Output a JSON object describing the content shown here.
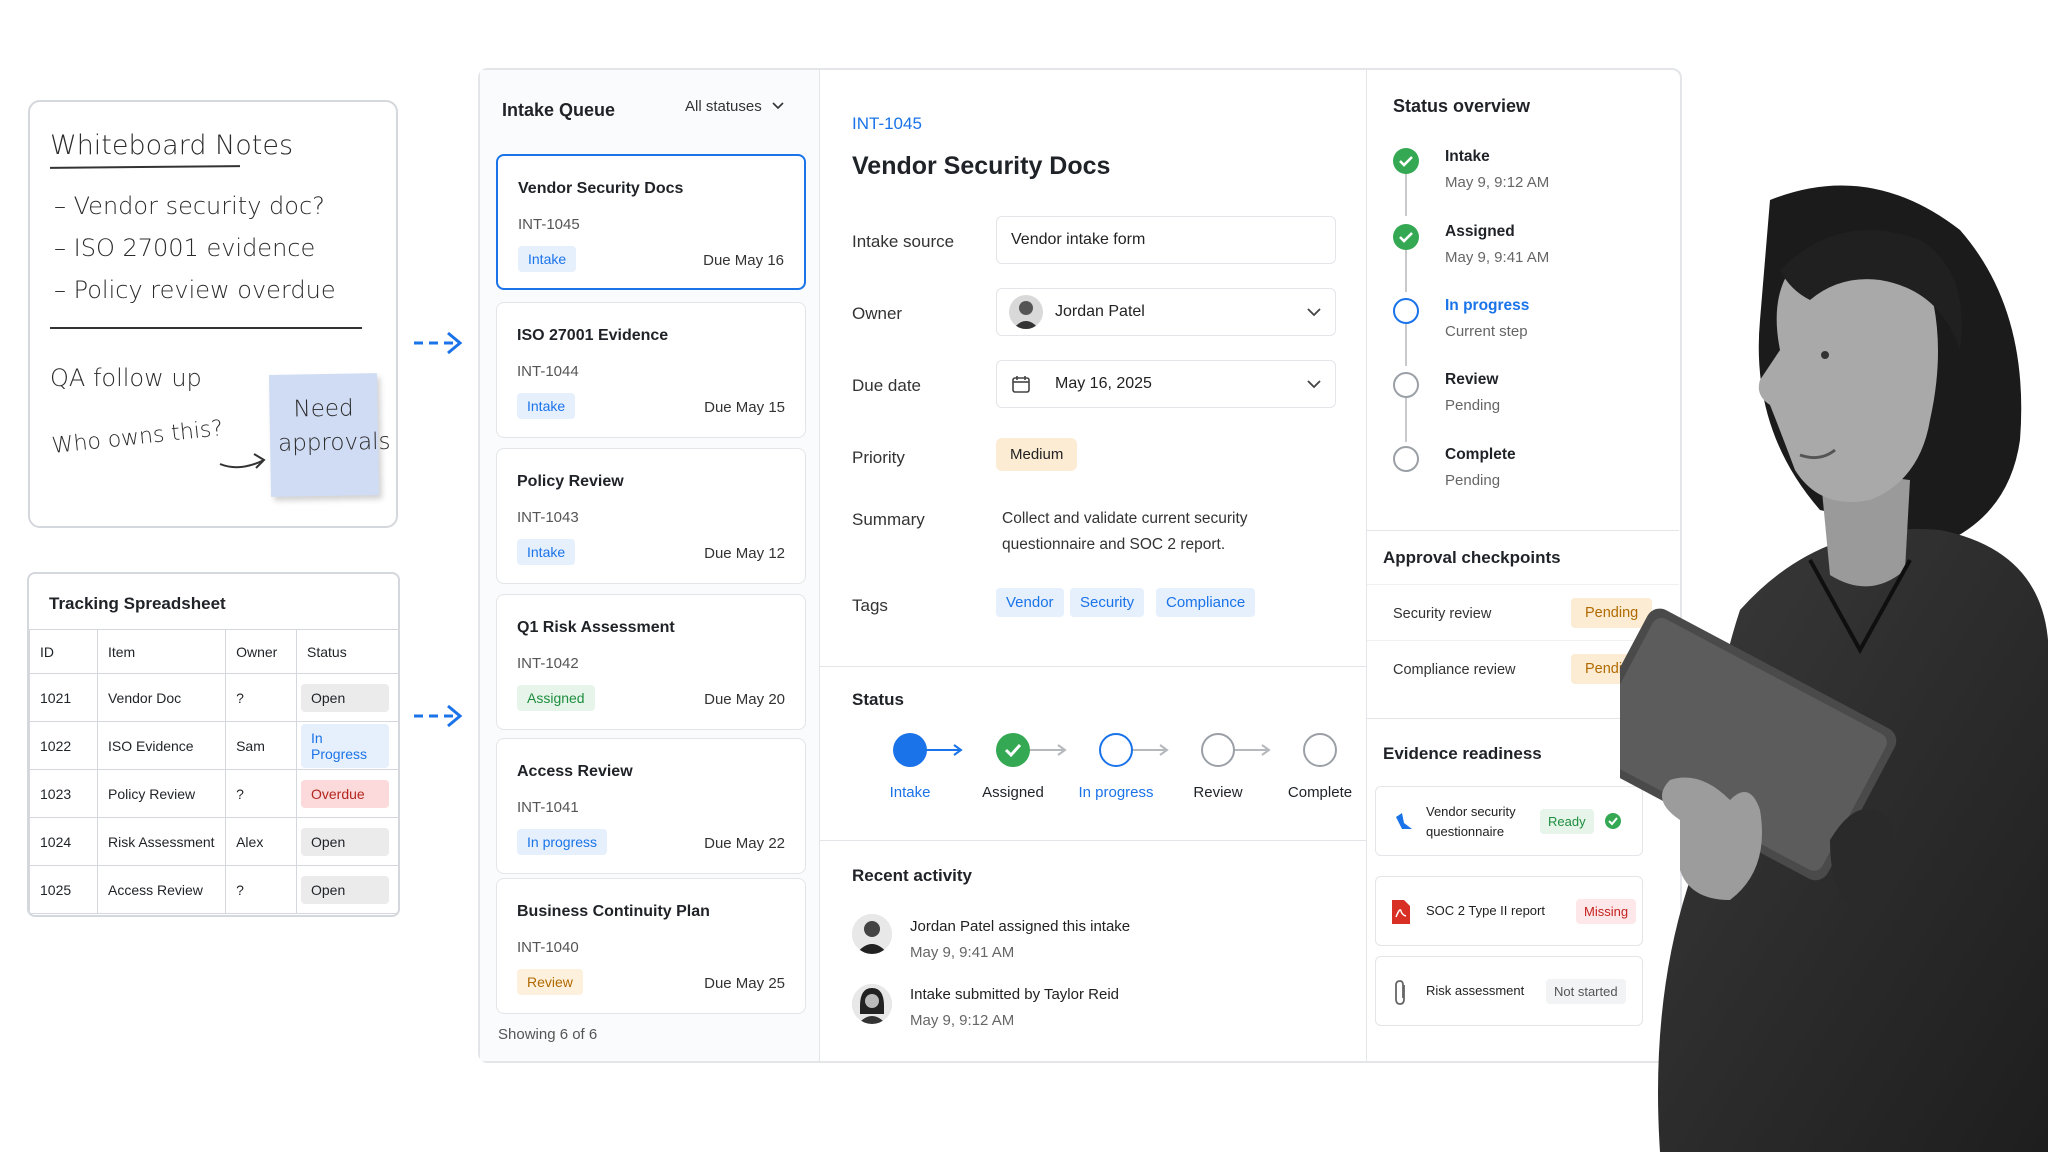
{
  "whiteboard": {
    "title": "Whiteboard Notes",
    "lines": [
      "– Vendor security doc?",
      "– ISO 27001 evidence",
      "– Policy review overdue"
    ],
    "qa": "QA follow up",
    "who": "Who owns this?",
    "sticky": [
      "Need",
      "approvals"
    ]
  },
  "spreadsheet": {
    "title": "Tracking Spreadsheet",
    "headers": [
      "ID",
      "Item",
      "Owner",
      "Status"
    ],
    "rows": [
      {
        "id": "1021",
        "item": "Vendor Doc",
        "owner": "?",
        "status": "Open"
      },
      {
        "id": "1022",
        "item": "ISO Evidence",
        "owner": "Sam",
        "status": "In Progress"
      },
      {
        "id": "1023",
        "item": "Policy Review",
        "owner": "?",
        "status": "Overdue"
      },
      {
        "id": "1024",
        "item": "Risk Assessment",
        "owner": "Alex",
        "status": "Open"
      },
      {
        "id": "1025",
        "item": "Access Review",
        "owner": "?",
        "status": "Open"
      }
    ]
  },
  "queue": {
    "title": "Intake Queue",
    "filter": "All statuses",
    "cards": [
      {
        "title": "Vendor Security Docs",
        "id": "INT-1045",
        "badge": "Intake",
        "due": "Due May 16"
      },
      {
        "title": "ISO 27001 Evidence",
        "id": "INT-1044",
        "badge": "Intake",
        "due": "Due May 15"
      },
      {
        "title": "Policy Review",
        "id": "INT-1043",
        "badge": "Intake",
        "due": "Due May 12"
      },
      {
        "title": "Q1 Risk Assessment",
        "id": "INT-1042",
        "badge": "Assigned",
        "due": "Due May 20"
      },
      {
        "title": "Access Review",
        "id": "INT-1041",
        "badge": "In progress",
        "due": "Due May 22"
      },
      {
        "title": "Business Continuity Plan",
        "id": "INT-1040",
        "badge": "Review",
        "due": "Due May 25"
      }
    ],
    "showing": "Showing 6 of 6"
  },
  "detail": {
    "id": "INT-1045",
    "title": "Vendor Security Docs",
    "labels": {
      "source": "Intake source",
      "owner": "Owner",
      "due": "Due date",
      "priority": "Priority",
      "summary": "Summary",
      "tags": "Tags"
    },
    "source": "Vendor intake form",
    "owner": "Jordan Patel",
    "due": "May 16, 2025",
    "priority": "Medium",
    "summary": "Collect and validate current security questionnaire and SOC 2 report.",
    "tags": [
      "Vendor",
      "Security",
      "Compliance"
    ],
    "status_label": "Status",
    "steps": [
      "Intake",
      "Assigned",
      "In progress",
      "Review",
      "Complete"
    ],
    "activity_label": "Recent activity",
    "activity": [
      {
        "text": "Jordan Patel assigned this intake",
        "time": "May 9, 9:41 AM"
      },
      {
        "text": "Intake submitted by Taylor Reid",
        "time": "May 9, 9:12 AM"
      }
    ]
  },
  "overview": {
    "title": "Status overview",
    "items": [
      {
        "name": "Intake",
        "sub": "May 9, 9:12 AM"
      },
      {
        "name": "Assigned",
        "sub": "May 9, 9:41 AM"
      },
      {
        "name": "In progress",
        "sub": "Current step"
      },
      {
        "name": "Review",
        "sub": "Pending"
      },
      {
        "name": "Complete",
        "sub": "Pending"
      }
    ]
  },
  "approvals": {
    "title": "Approval checkpoints",
    "rows": [
      {
        "name": "Security review",
        "status": "Pending"
      },
      {
        "name": "Compliance review",
        "status": "Pending"
      }
    ]
  },
  "evidence": {
    "title": "Evidence readiness",
    "items": [
      {
        "name": "Vendor security questionnaire",
        "status": "Ready"
      },
      {
        "name": "SOC 2 Type II report",
        "status": "Missing"
      },
      {
        "name": "Risk assessment",
        "status": "Not started"
      }
    ]
  },
  "colors": {
    "accent": "#1a73e8",
    "success": "#34a853",
    "warning": "#b06a00",
    "danger": "#d93025"
  }
}
